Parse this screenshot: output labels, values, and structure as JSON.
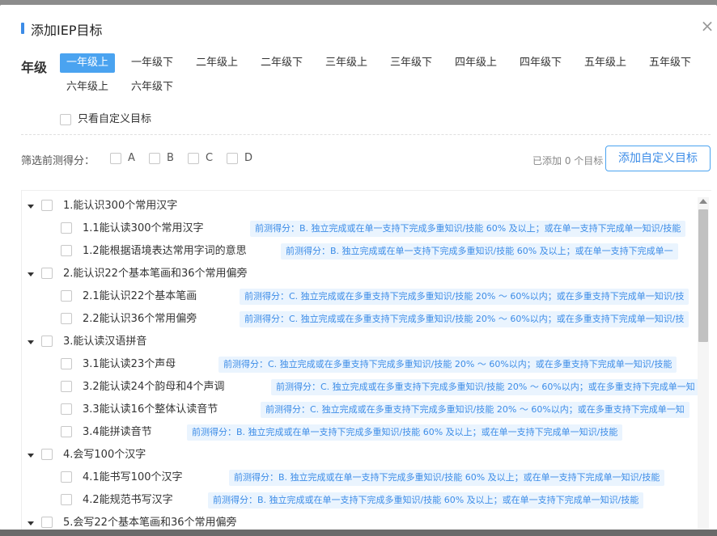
{
  "dialog": {
    "title": "添加IEP目标",
    "close_icon": "close-icon"
  },
  "grades": {
    "label": "年级",
    "tabs": [
      "一年级上",
      "一年级下",
      "二年级上",
      "二年级下",
      "三年级上",
      "三年级下",
      "四年级上",
      "四年级下",
      "五年级上",
      "五年级下",
      "六年级上",
      "六年级下"
    ],
    "active_index": 0
  },
  "custom_only": {
    "label": "只看自定义目标",
    "checked": false
  },
  "filter": {
    "label": "筛选前测得分：",
    "options": [
      "A",
      "B",
      "C",
      "D"
    ],
    "added_text": "已添加 0 个目标",
    "add_button": "添加自定义目标"
  },
  "goals": [
    {
      "label": "1.能认识300个常用汉字",
      "children": [
        {
          "label": "1.1能认读300个常用汉字",
          "score": "前测得分：B. 独立完成或在单一支持下完成多重知识/技能 60% 及以上；或在单一支持下完成单一知识/技能"
        },
        {
          "label": "1.2能根据语境表达常用字词的意思",
          "score": "前测得分：B. 独立完成或在单一支持下完成多重知识/技能 60% 及以上；或在单一支持下完成单一"
        }
      ]
    },
    {
      "label": "2.能认识22个基本笔画和36个常用偏旁",
      "children": [
        {
          "label": "2.1能认识22个基本笔画",
          "score": "前测得分：C. 独立完成或在多重支持下完成多重知识/技能 20% ～ 60%以内；或在多重支持下完成单一知识/技"
        },
        {
          "label": "2.2能认识36个常用偏旁",
          "score": "前测得分：C. 独立完成或在多重支持下完成多重知识/技能 20% ～ 60%以内；或在多重支持下完成单一知识/技"
        }
      ]
    },
    {
      "label": "3.能认读汉语拼音",
      "children": [
        {
          "label": "3.1能认读23个声母",
          "score": "前测得分：C. 独立完成或在多重支持下完成多重知识/技能 20% ～ 60%以内；或在多重支持下完成单一知识/技能"
        },
        {
          "label": "3.2能认读24个韵母和4个声调",
          "score": "前测得分：C. 独立完成或在多重支持下完成多重知识/技能 20% ～ 60%以内；或在多重支持下完成单一知"
        },
        {
          "label": "3.3能认读16个整体认读音节",
          "score": "前测得分：C. 独立完成或在多重支持下完成多重知识/技能 20% ～ 60%以内；或在多重支持下完成单一知"
        },
        {
          "label": "3.4能拼读音节",
          "score": "前测得分：B. 独立完成或在单一支持下完成多重知识/技能 60% 及以上；或在单一支持下完成单一知识/技能"
        }
      ]
    },
    {
      "label": "4.会写100个汉字",
      "children": [
        {
          "label": "4.1能书写100个汉字",
          "score": "前测得分：B. 独立完成或在单一支持下完成多重知识/技能 60% 及以上；或在单一支持下完成单一知识/技能"
        },
        {
          "label": "4.2能规范书写汉字",
          "score": "前测得分：B. 独立完成或在单一支持下完成多重知识/技能 60% 及以上；或在单一支持下完成单一知识/技能"
        }
      ]
    },
    {
      "label": "5.会写22个基本笔画和36个常用偏旁",
      "children": []
    }
  ],
  "colors": {
    "accent": "#3c8ce7",
    "active_tab": "#4aa3f0",
    "tag_bg": "#eaf4fe"
  }
}
